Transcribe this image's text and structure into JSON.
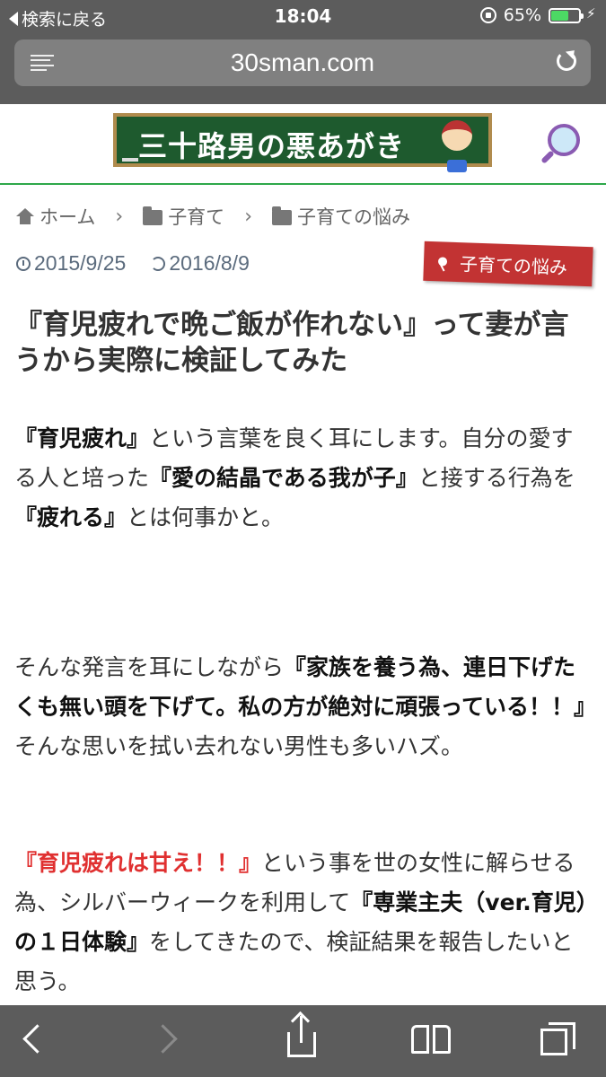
{
  "status_bar": {
    "back_app": "検索に戻る",
    "time": "18:04",
    "battery_percent": "65%",
    "battery_level": 0.65
  },
  "browser": {
    "domain": "30sman.com"
  },
  "site": {
    "logo_text": "三十路男の悪あがき"
  },
  "breadcrumb": {
    "home": "ホーム",
    "category": "子育て",
    "subcategory": "子育ての悩み",
    "separator": "›"
  },
  "post": {
    "published": "2015/9/25",
    "updated": "2016/8/9",
    "category_tag": "子育ての悩み",
    "title": "『育児疲れで晩ご飯が作れない』って妻が言うから実際に検証してみた",
    "p1": {
      "b1": "『育児疲れ』",
      "t1": "という言葉を良く耳にします。自分の愛する人と培った",
      "b2": "『愛の結晶である我が子』",
      "t2": "と接する行為を",
      "b3": "『疲れる』",
      "t3": "とは何事かと。"
    },
    "p2": {
      "t1": "そんな発言を耳にしながら",
      "b1": "『家族を養う為、連日下げたくも無い頭を下げて。私の方が絶対に頑張っている！！』",
      "t2": "そんな思いを拭い去れない男性も多いハズ。"
    },
    "p3": {
      "r1": "『育児疲れは甘え！！』",
      "t1": "という事を世の女性に解らせる為、シルバーウィークを利用して",
      "b1": "『専業主夫（ver.育児）の１日体験』",
      "t2": "をしてきたので、検証結果を報告したいと思う。"
    }
  },
  "icons": {
    "back": "chevron-left-icon",
    "forward": "chevron-right-icon",
    "share": "share-icon",
    "bookmarks": "book-icon",
    "tabs": "tabs-icon"
  },
  "colors": {
    "chrome": "#5c5c5c",
    "accent_green": "#2ea84a",
    "tag_red": "#c23333",
    "emphasis_red": "#e03030",
    "date_blue_gray": "#5b6b7d"
  }
}
